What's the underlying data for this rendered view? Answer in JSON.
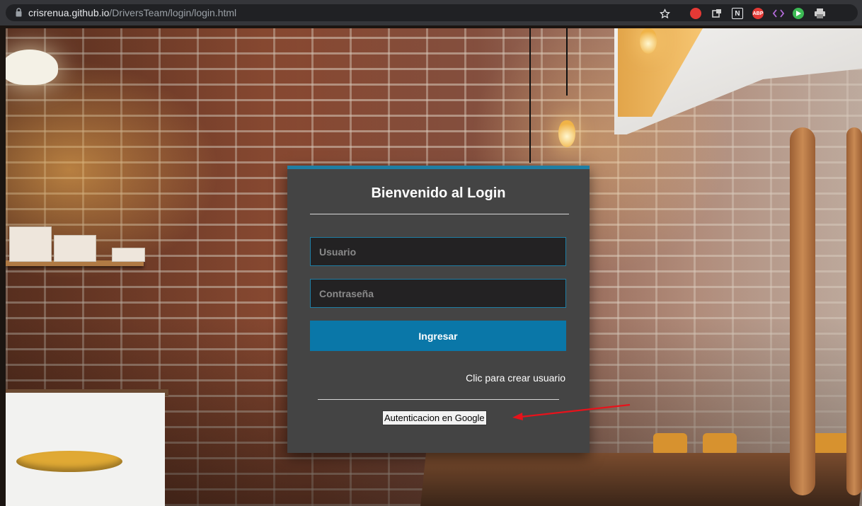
{
  "browser": {
    "url_domain": "crisrenua.github.io",
    "url_path": "/DriversTeam/login/login.html",
    "bookmark_icon": "star-icon",
    "extensions": [
      "stop-hand-icon",
      "extension-icon",
      "notion-icon",
      "adblock-icon",
      "code-icon",
      "play-icon",
      "printer-icon"
    ],
    "adblock_label": "ABP",
    "notion_label": "N"
  },
  "login": {
    "title": "Bienvenido al Login",
    "username_placeholder": "Usuario",
    "password_placeholder": "Contraseña",
    "submit_label": "Ingresar",
    "create_user_link": "Clic para crear usuario",
    "google_button": "Autenticacion en Google"
  },
  "colors": {
    "card_bg": "#444444",
    "accent": "#0a77a8",
    "card_top_border": "#1f7ea4",
    "annotation_arrow": "#e8121b"
  }
}
